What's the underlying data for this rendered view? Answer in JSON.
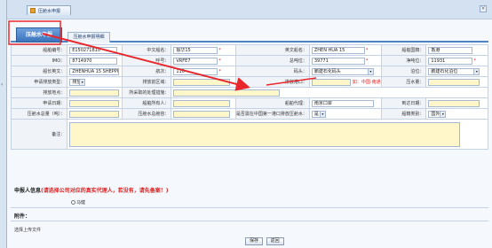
{
  "window": {
    "tab_title": "压舱水申报",
    "close_glyph": "×",
    "collapse_glyph": "‹"
  },
  "tabs": {
    "active": "压舱水申报",
    "other": "压舱水申报明细"
  },
  "colors": {
    "accent": "#3b73bb",
    "required": "#e02020",
    "highlight_field": "#fff7c9",
    "annotation": "#e8272d"
  },
  "form": {
    "ship_no_label": "船舶编号：",
    "ship_no": "E150271810",
    "cn_name_label": "中文船名：",
    "cn_name": "振华15",
    "en_name_label": "英文船名：",
    "en_name": "ZHEN HUA 15",
    "nationality_label": "船舶国籍：",
    "nationality": "香港",
    "imo_label": "IMO：",
    "imo": "8714970",
    "callsign_label": "呼号：",
    "callsign": "VRFE7",
    "gross_ton_label": "总吨位：",
    "gross_ton": "39771",
    "net_ton_label": "净吨位：",
    "net_ton": "11931",
    "ship_en_label": "船长英文：",
    "ship_en": "ZHENHUA 15 SHEPPIN",
    "voyage_label": "航次：",
    "voyage": "110",
    "berth_label": "码头：",
    "berth": "鹏建石化码头",
    "location_label": "泊位：",
    "location": "鹏建石化泊位",
    "declare_type_label": "申请排放类型：",
    "declare_type": "排放",
    "discharge_port_label": "排放前区域：",
    "discharge_port": "",
    "source_port_label": "排放港口：",
    "source_port": "",
    "hint_text": "如：中国-南通",
    "water_qty_label": "压水量：",
    "water_qty": "",
    "water_place_label": "排放地点：",
    "water_place": "",
    "treatment_label": "所采取的处理措施：",
    "treatment": "",
    "declare_date_label": "申请日期：",
    "declare_date": "",
    "agent_label": "船舶所有人：",
    "agent": "",
    "agent_code_label": "船舶代理：",
    "agent_code": "南京口岸",
    "arrival_date_label": "到达日期：",
    "arrival_date": "",
    "ballast_total_label": "压舱水总量（吨）：",
    "ballast_total": "",
    "ballast_dest_label": "压舱水总舱容：",
    "ballast_dest": "",
    "inspection_label": "是否需在中国第一港口排放压舱水：",
    "inspection": "是",
    "report_port_label": "船籍类别：",
    "report_port": "国外",
    "remark_label": "备注："
  },
  "applicant": {
    "title": "申报人信息",
    "warning": "(请选择公司对应的真实代理人，若没有，请先备案！)",
    "radio_label": "马健"
  },
  "attachments": {
    "title": "附件：",
    "upload_label": "选择上传文件"
  },
  "buttons": {
    "save": "保存",
    "back": "返回"
  }
}
